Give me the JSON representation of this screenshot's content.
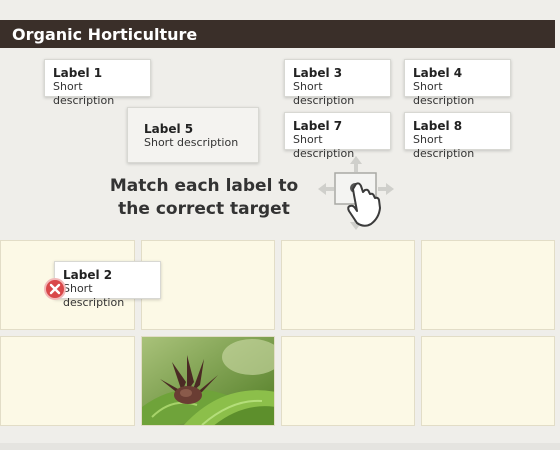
{
  "header": {
    "title": "Organic Horticulture"
  },
  "instruction": {
    "line1": "Match each label to",
    "line2": "the correct target"
  },
  "cards": {
    "label1": {
      "label": "Label 1",
      "description": "Short description"
    },
    "label2": {
      "label": "Label 2",
      "description": "Short description"
    },
    "label3": {
      "label": "Label 3",
      "description": "Short description"
    },
    "label4": {
      "label": "Label 4",
      "description": "Short description"
    },
    "label5": {
      "label": "Label 5",
      "description": "Short description"
    },
    "label7": {
      "label": "Label 7",
      "description": "Short description"
    },
    "label8": {
      "label": "Label 8",
      "description": "Short description"
    }
  },
  "icons": {
    "drag_hint": "hand-drag-icon",
    "incorrect": "close-icon"
  },
  "colors": {
    "title_bar": "#3a2f29",
    "target_bg": "#fcf9e6",
    "incorrect": "#d9484a"
  }
}
